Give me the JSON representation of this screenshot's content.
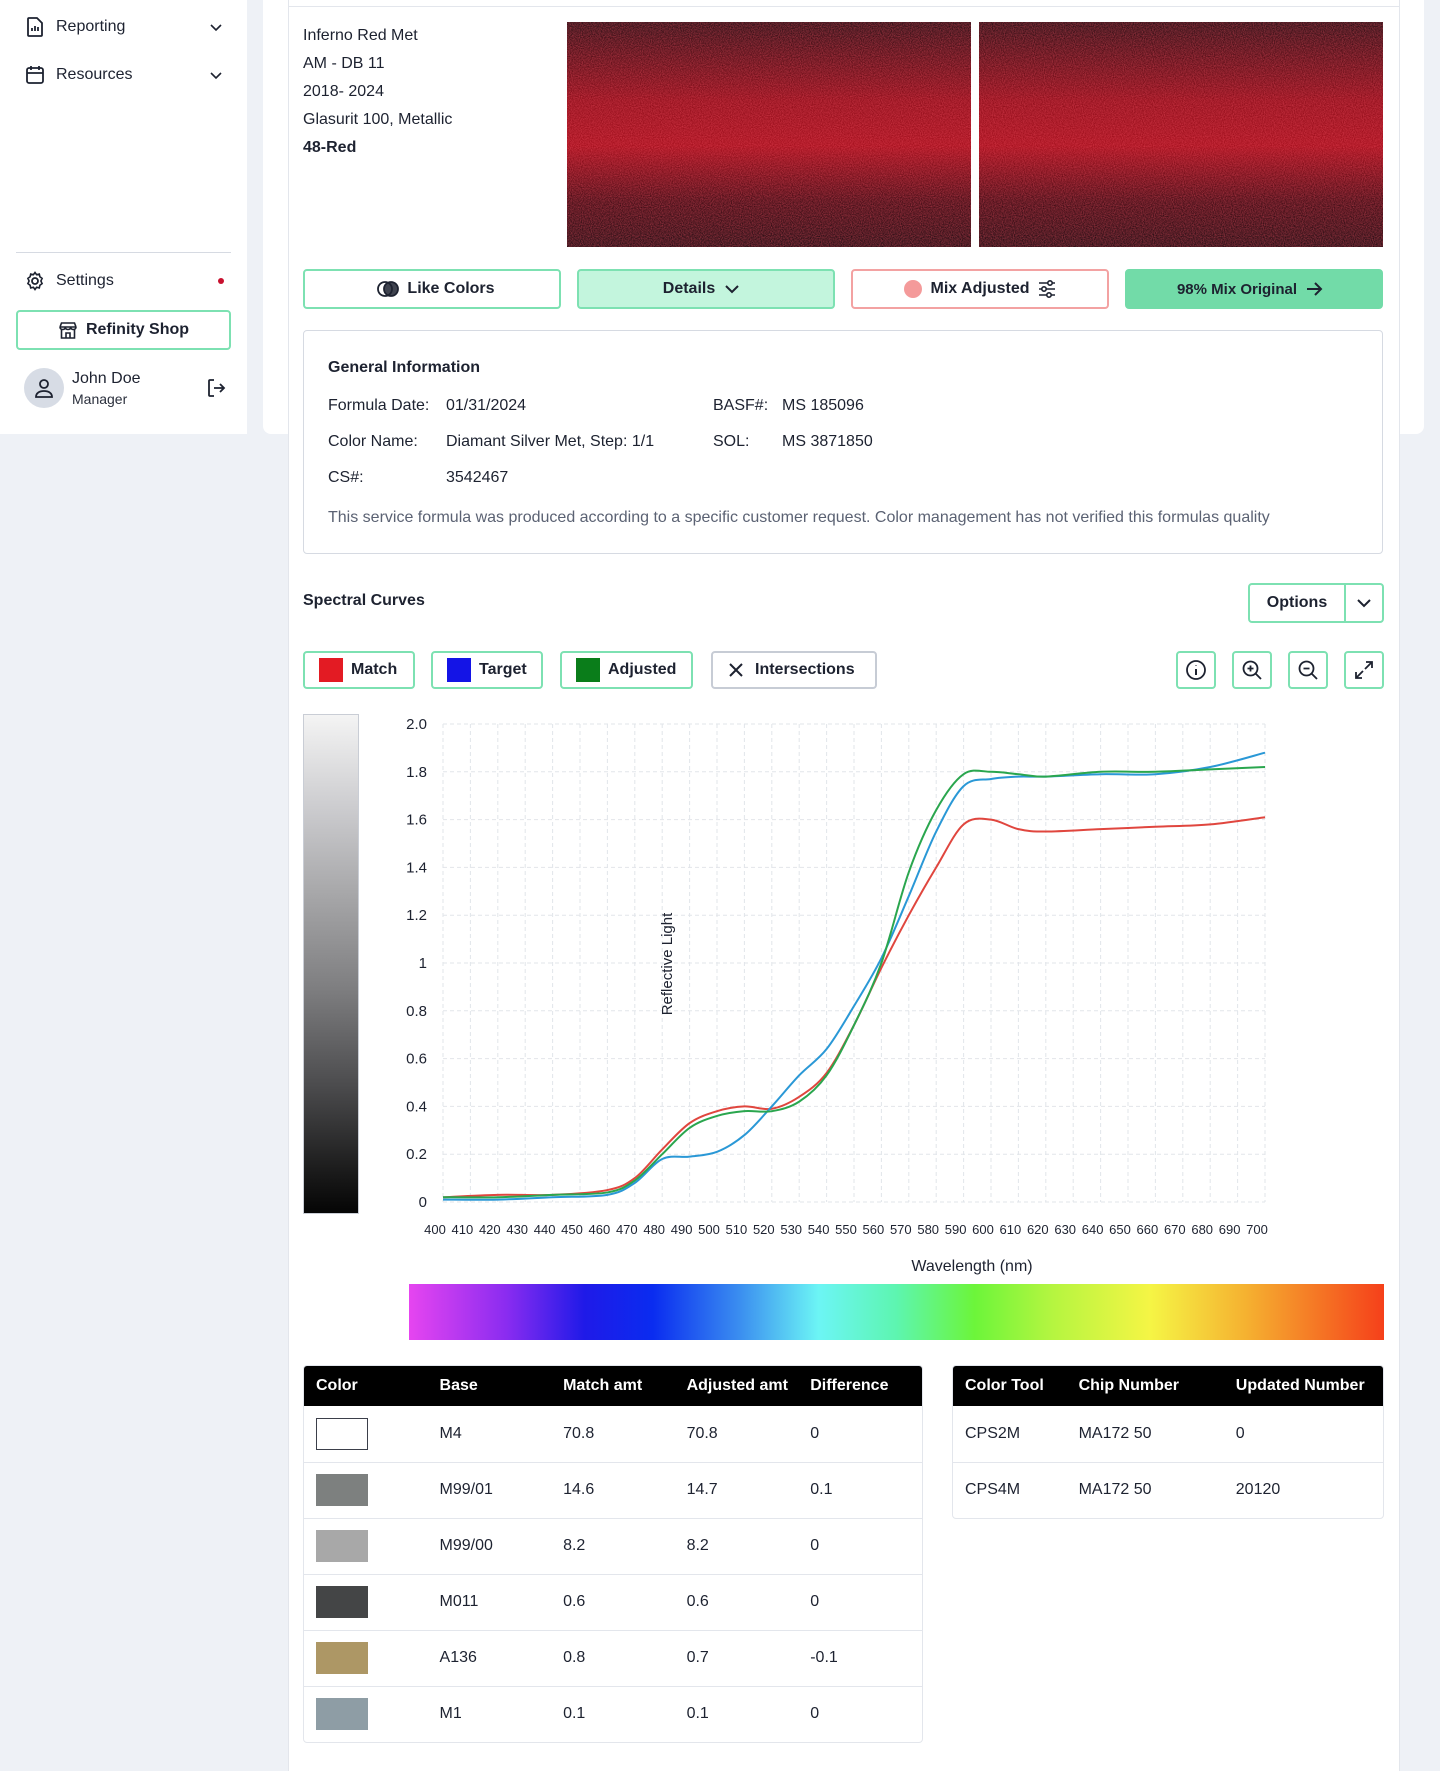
{
  "sidebar": {
    "reporting": "Reporting",
    "resources": "Resources",
    "settings": "Settings",
    "shop": "Refinity Shop",
    "user_name": "John Doe",
    "user_role": "Manager"
  },
  "paint": {
    "name": "Inferno Red Met",
    "code": "AM - DB 11",
    "years": "2018- 2024",
    "line": "Glasurit 100, Metallic",
    "group": "48-Red"
  },
  "actions": {
    "like_colors": "Like Colors",
    "details": "Details",
    "mix_adjusted": "Mix Adjusted",
    "mix_original": "98% Mix Original"
  },
  "general": {
    "title": "General Information",
    "formula_date_label": "Formula Date:",
    "formula_date": "01/31/2024",
    "color_name_label": "Color Name:",
    "color_name": "Diamant Silver Met, Step: 1/1",
    "cs_label": "CS#:",
    "cs": "3542467",
    "basf_label": "BASF#:",
    "basf": "MS 185096",
    "sol_label": "SOL:",
    "sol": "MS 3871850",
    "note": "This service formula was produced according to a specific customer request. Color management has not verified this formulas quality"
  },
  "spectral": {
    "title": "Spectral Curves",
    "options": "Options",
    "legend": {
      "match": "Match",
      "target": "Target",
      "adjusted": "Adjusted",
      "intersections": "Intersections"
    }
  },
  "colors": {
    "match": "#e31b23",
    "target": "#1414e6",
    "adjusted": "#0a7d1a",
    "accent": "#7de1b2",
    "line_match": "#e0463e",
    "line_target": "#2a98d6",
    "line_adjusted": "#2aa64e"
  },
  "chart_data": {
    "type": "line",
    "xlabel": "Wavelength (nm)",
    "ylabel": "Reflective Light",
    "xlim": [
      400,
      700
    ],
    "ylim": [
      0,
      2.0
    ],
    "xticks": [
      "400",
      "410",
      "420",
      "430",
      "440",
      "450",
      "460",
      "470",
      "480",
      "490",
      "500",
      "510",
      "520",
      "530",
      "540",
      "550",
      "560",
      "570",
      "580",
      "590",
      "600",
      "610",
      "620",
      "630",
      "640",
      "650",
      "660",
      "670",
      "680",
      "690",
      "700"
    ],
    "yticks": [
      "0",
      "0.2",
      "0.4",
      "0.6",
      "0.8",
      "1",
      "1.2",
      "1.4",
      "1.6",
      "1.8",
      "2.0"
    ],
    "grid": true,
    "x": [
      400,
      420,
      440,
      460,
      470,
      480,
      490,
      500,
      510,
      520,
      530,
      540,
      550,
      560,
      570,
      580,
      590,
      600,
      610,
      620,
      640,
      660,
      680,
      700
    ],
    "series": [
      {
        "name": "Match",
        "values": [
          0.02,
          0.03,
          0.03,
          0.05,
          0.1,
          0.22,
          0.33,
          0.38,
          0.4,
          0.39,
          0.44,
          0.54,
          0.74,
          0.98,
          1.2,
          1.4,
          1.58,
          1.6,
          1.56,
          1.55,
          1.56,
          1.57,
          1.58,
          1.61
        ]
      },
      {
        "name": "Target",
        "values": [
          0.01,
          0.01,
          0.02,
          0.03,
          0.08,
          0.18,
          0.19,
          0.21,
          0.28,
          0.4,
          0.53,
          0.64,
          0.82,
          1.02,
          1.28,
          1.55,
          1.74,
          1.77,
          1.78,
          1.78,
          1.79,
          1.79,
          1.82,
          1.88
        ]
      },
      {
        "name": "Adjusted",
        "values": [
          0.02,
          0.02,
          0.03,
          0.04,
          0.09,
          0.2,
          0.31,
          0.36,
          0.38,
          0.38,
          0.42,
          0.53,
          0.74,
          1.0,
          1.38,
          1.64,
          1.79,
          1.8,
          1.79,
          1.78,
          1.8,
          1.8,
          1.81,
          1.82
        ]
      }
    ]
  },
  "base_table": {
    "headers": [
      "Color",
      "Base",
      "Match amt",
      "Adjusted amt",
      "Difference"
    ],
    "rows": [
      {
        "color": "#ffffff",
        "base": "M4",
        "match": "70.8",
        "adjusted": "70.8",
        "diff": "0"
      },
      {
        "color": "#7d807f",
        "base": "M99/01",
        "match": "14.6",
        "adjusted": "14.7",
        "diff": "0.1"
      },
      {
        "color": "#a8a8a8",
        "base": "M99/00",
        "match": "8.2",
        "adjusted": "8.2",
        "diff": "0"
      },
      {
        "color": "#444546",
        "base": "M011",
        "match": "0.6",
        "adjusted": "0.6",
        "diff": "0"
      },
      {
        "color": "#ad9765",
        "base": "A136",
        "match": "0.8",
        "adjusted": "0.7",
        "diff": "-0.1"
      },
      {
        "color": "#8e9da5",
        "base": "M1",
        "match": "0.1",
        "adjusted": "0.1",
        "diff": "0"
      }
    ]
  },
  "tool_table": {
    "headers": [
      "Color Tool",
      "Chip Number",
      "Updated Number"
    ],
    "rows": [
      {
        "tool": "CPS2M",
        "chip": "MA172 50",
        "updated": "0"
      },
      {
        "tool": "CPS4M",
        "chip": "MA172 50",
        "updated": "20120"
      }
    ]
  }
}
